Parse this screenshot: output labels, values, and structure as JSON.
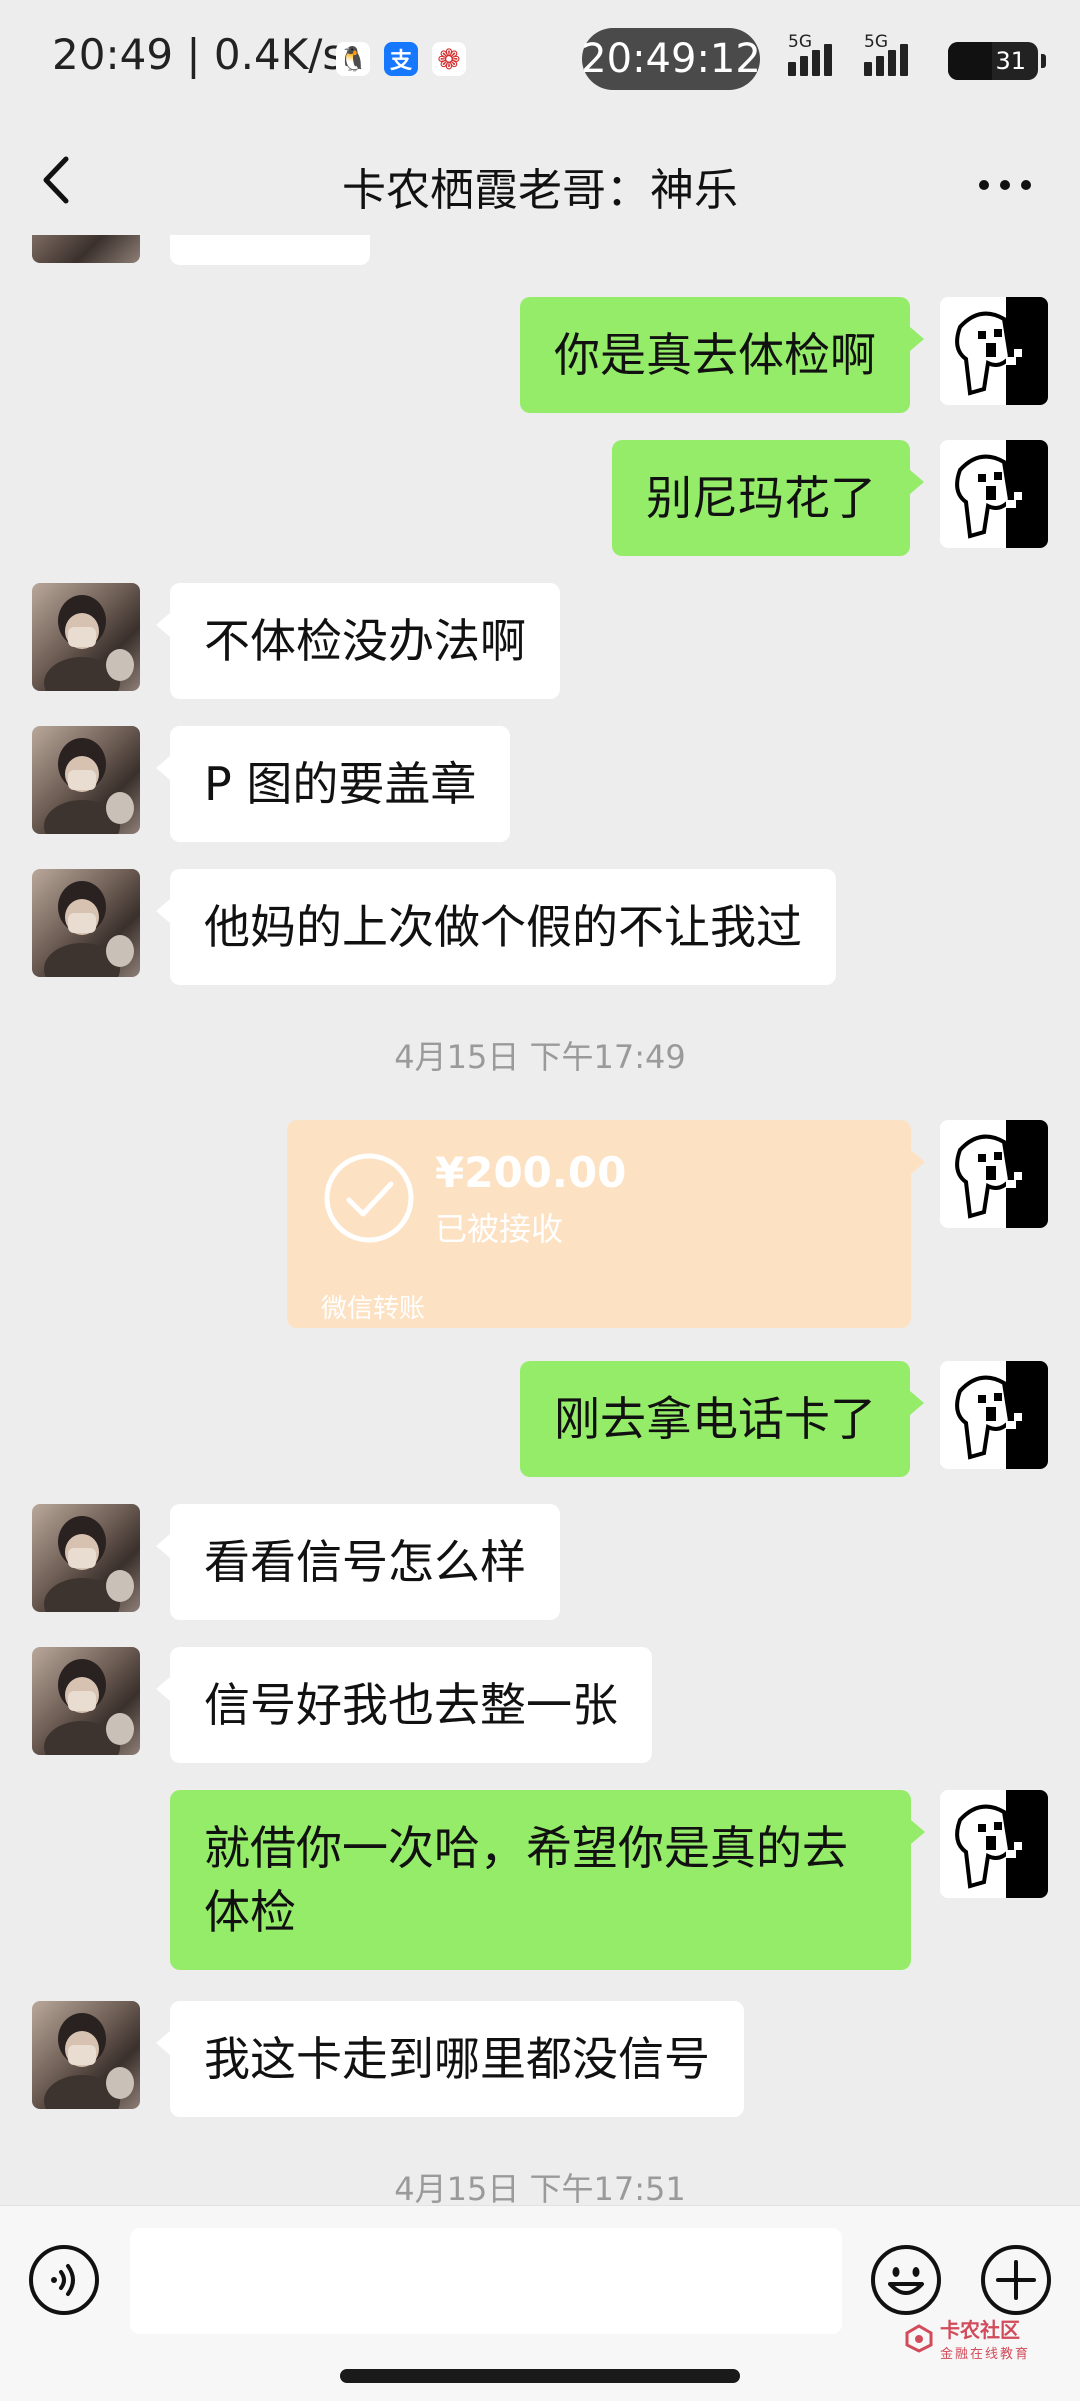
{
  "status_bar": {
    "time": "20:49",
    "net_speed": "0.4K/s",
    "clock": "20:49:12",
    "network_1": "5G",
    "network_2": "5G",
    "battery": "31",
    "app_icons": [
      "qq-icon",
      "alipay-icon",
      "rose-icon"
    ]
  },
  "header": {
    "title": "卡农栖霞老哥：神乐",
    "back_icon": "chevron-left-icon",
    "more_icon": "ellipsis-icon"
  },
  "messages": [
    {
      "side": "in",
      "text": ""
    },
    {
      "side": "out",
      "text": "你是真去体检啊"
    },
    {
      "side": "out",
      "text": "别尼玛花了"
    },
    {
      "side": "in",
      "text": "不体检没办法啊"
    },
    {
      "side": "in",
      "text": "P 图的要盖章"
    },
    {
      "side": "in",
      "text": "他妈的上次做个假的不让我过"
    },
    {
      "side": "out",
      "text": "刚去拿电话卡了"
    },
    {
      "side": "in",
      "text": "看看信号怎么样"
    },
    {
      "side": "in",
      "text": "信号好我也去整一张"
    },
    {
      "side": "out",
      "text": "就借你一次哈，希望你是真的去体检"
    },
    {
      "side": "in",
      "text": "我这卡走到哪里都没信号"
    }
  ],
  "timestamps": [
    "4月15日 下午17:49",
    "4月15日 下午17:51"
  ],
  "transfer": {
    "amount": "¥200.00",
    "status": "已被接收",
    "source": "微信转账",
    "color": "#fde1c3"
  },
  "input_bar": {
    "placeholder": "",
    "voice_icon": "voice-icon",
    "emoji_icon": "emoji-icon",
    "plus_icon": "plus-icon"
  },
  "watermark": {
    "text": "卡农社区",
    "subtext": "金融在线教育"
  },
  "colors": {
    "background": "#ededed",
    "outgoing_bubble": "#95ec69",
    "incoming_bubble": "#ffffff"
  }
}
